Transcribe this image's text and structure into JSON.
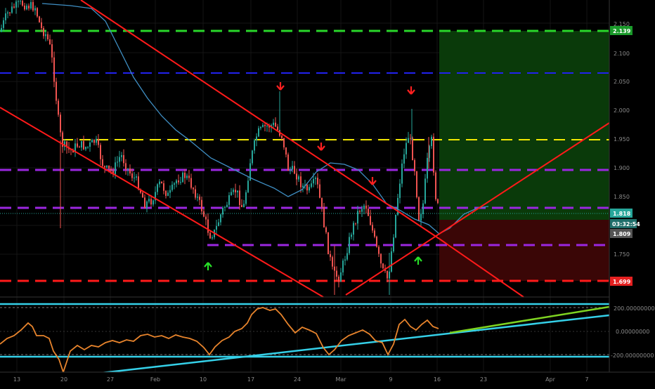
{
  "colors": {
    "background": "#000000",
    "grid": "#1c1c1c",
    "axis_text": "#8a8a8a",
    "candle_up": "#26a69a",
    "candle_down": "#ef5350",
    "moving_average": "#3f8fc4",
    "trendline": "#ff1a1a",
    "oscillator": "#e8842c",
    "cyan_line": "#35d0e8",
    "green_line": "#7ed321",
    "level_green": "#29d62a",
    "level_blue": "#2222ee",
    "level_yellow": "#f2e800",
    "level_purple": "#9b27e0",
    "level_red": "#ff1a1a",
    "profit_zone": "#0a3a0a",
    "loss_zone": "#3a0606",
    "buy_arrow": "#28e028",
    "sell_arrow": "#ff2020"
  },
  "price_axis": {
    "ticks": [
      "2.150",
      "2.100",
      "2.050",
      "2.000",
      "1.950",
      "1.900",
      "1.850",
      "1.750"
    ]
  },
  "price_tags": {
    "target": {
      "label": "2.139",
      "color": "#1a9a2a"
    },
    "current": {
      "label": "1.818",
      "color": "#26a69a"
    },
    "countdown": {
      "label": "03:32:54",
      "color": "#1f6e6a"
    },
    "entry": {
      "label": "1.809",
      "color": "#555555"
    },
    "stop": {
      "label": "1.699",
      "color": "#e52020"
    }
  },
  "oscillator_axis": {
    "ticks": [
      "200.00000000",
      "0.00000000",
      "-200.00000000"
    ]
  },
  "time_axis": {
    "ticks": [
      "13",
      "20",
      "27",
      "Feb",
      "10",
      "17",
      "24",
      "Mar",
      "9",
      "16",
      "23",
      "Apr",
      "7"
    ]
  },
  "chart_data": [
    {
      "type": "line",
      "title": "",
      "price_axis_ticks": [
        2.15,
        2.1,
        2.05,
        2.0,
        1.95,
        1.9,
        1.85,
        1.75
      ],
      "horizontal_levels": [
        {
          "color": "green",
          "price": 2.139
        },
        {
          "color": "blue",
          "price": 2.064
        },
        {
          "color": "yellow",
          "price": 1.948
        },
        {
          "color": "purple",
          "price": 1.894
        },
        {
          "color": "purple",
          "price": 1.826
        },
        {
          "color": "purple",
          "price": 1.764
        },
        {
          "color": "red",
          "price": 1.699
        }
      ],
      "marked_prices": {
        "target": 2.139,
        "current": 1.818,
        "entry": 1.809,
        "stop": 1.699
      },
      "close_series": {
        "x": [
          "Jan 13",
          "Jan 16",
          "Jan 19",
          "Jan 20",
          "Jan 23",
          "Jan 27",
          "Jan 30",
          "Feb 3",
          "Feb 6",
          "Feb 10",
          "Feb 13",
          "Feb 17",
          "Feb 20",
          "Feb 24",
          "Feb 27",
          "Mar 2",
          "Mar 5",
          "Mar 9",
          "Mar 11",
          "Mar 13",
          "Mar 16"
        ],
        "y": [
          2.17,
          2.17,
          2.1,
          1.95,
          1.9,
          1.89,
          1.87,
          1.84,
          1.86,
          1.78,
          1.8,
          1.9,
          1.95,
          1.86,
          1.85,
          1.74,
          1.82,
          1.73,
          1.93,
          1.8,
          1.82
        ]
      }
    },
    {
      "type": "line",
      "title": "",
      "ylim": [
        -200,
        200
      ],
      "yticks": [
        200,
        0,
        -200
      ]
    }
  ]
}
